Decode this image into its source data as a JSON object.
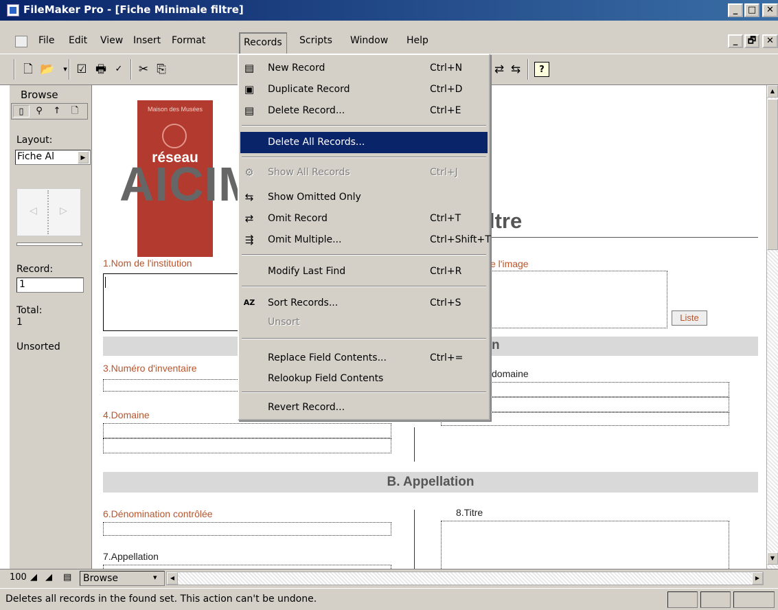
{
  "window": {
    "title": "FileMaker Pro - [Fiche Minimale filtre]",
    "controls": [
      "_",
      "□",
      "✕"
    ],
    "doc_controls": [
      "_",
      "🗗",
      "✕"
    ]
  },
  "menubar": {
    "items": [
      "File",
      "Edit",
      "View",
      "Insert",
      "Format",
      "Records",
      "Scripts",
      "Window",
      "Help"
    ],
    "open": "Records"
  },
  "records_menu": {
    "new_record": {
      "label": "New Record",
      "shortcut": "Ctrl+N"
    },
    "duplicate_record": {
      "label": "Duplicate Record",
      "shortcut": "Ctrl+D"
    },
    "delete_record": {
      "label": "Delete Record...",
      "shortcut": "Ctrl+E"
    },
    "delete_all_records": {
      "label": "Delete All Records...",
      "shortcut": ""
    },
    "show_all_records": {
      "label": "Show All Records",
      "shortcut": "Ctrl+J"
    },
    "show_omitted_only": {
      "label": "Show Omitted Only",
      "shortcut": ""
    },
    "omit_record": {
      "label": "Omit Record",
      "shortcut": "Ctrl+T"
    },
    "omit_multiple": {
      "label": "Omit Multiple...",
      "shortcut": "Ctrl+Shift+T"
    },
    "modify_last_find": {
      "label": "Modify Last Find",
      "shortcut": "Ctrl+R"
    },
    "sort_records": {
      "label": "Sort Records...",
      "shortcut": "Ctrl+S"
    },
    "unsort": {
      "label": "Unsort",
      "shortcut": ""
    },
    "replace_field_contents": {
      "label": "Replace Field Contents...",
      "shortcut": "Ctrl+="
    },
    "relookup_field_contents": {
      "label": "Relookup Field Contents",
      "shortcut": ""
    },
    "revert_record": {
      "label": "Revert Record...",
      "shortcut": ""
    }
  },
  "status_area": {
    "mode": "Browse",
    "layout_label": "Layout:",
    "layout_value": "Fiche Al",
    "record_label": "Record:",
    "record_value": "1",
    "total_label": "Total:",
    "total_value": "1",
    "sort_state": "Unsorted"
  },
  "layout": {
    "logo_org": "Maison des Musées",
    "logo_word": "réseau",
    "logo_letters": "AICIM",
    "title_fragment": "ltre",
    "fields": {
      "f1": "1.Nom de l'institution",
      "f_image": "e l'image",
      "f3": "3.Numéro d'inventaire",
      "f_domaine": "domaine",
      "f4": "4.Domaine",
      "f6": "6.Dénomination contrôlée",
      "f7": "7.Appellation",
      "f8": "8.Titre"
    },
    "liste_button": "Liste",
    "section_a_fragment": "n",
    "section_b": "B. Appellation"
  },
  "bottom": {
    "zoom": "100",
    "mode_select": "Browse"
  },
  "statusbar": {
    "message": "Deletes all records in the found set. This action can't be undone."
  },
  "colors": {
    "titlebar": "#0a246a",
    "highlight": "#0a246a",
    "chrome": "#d4d0c8",
    "field_label": "#b8542a",
    "logo_red": "#b33a2e"
  }
}
